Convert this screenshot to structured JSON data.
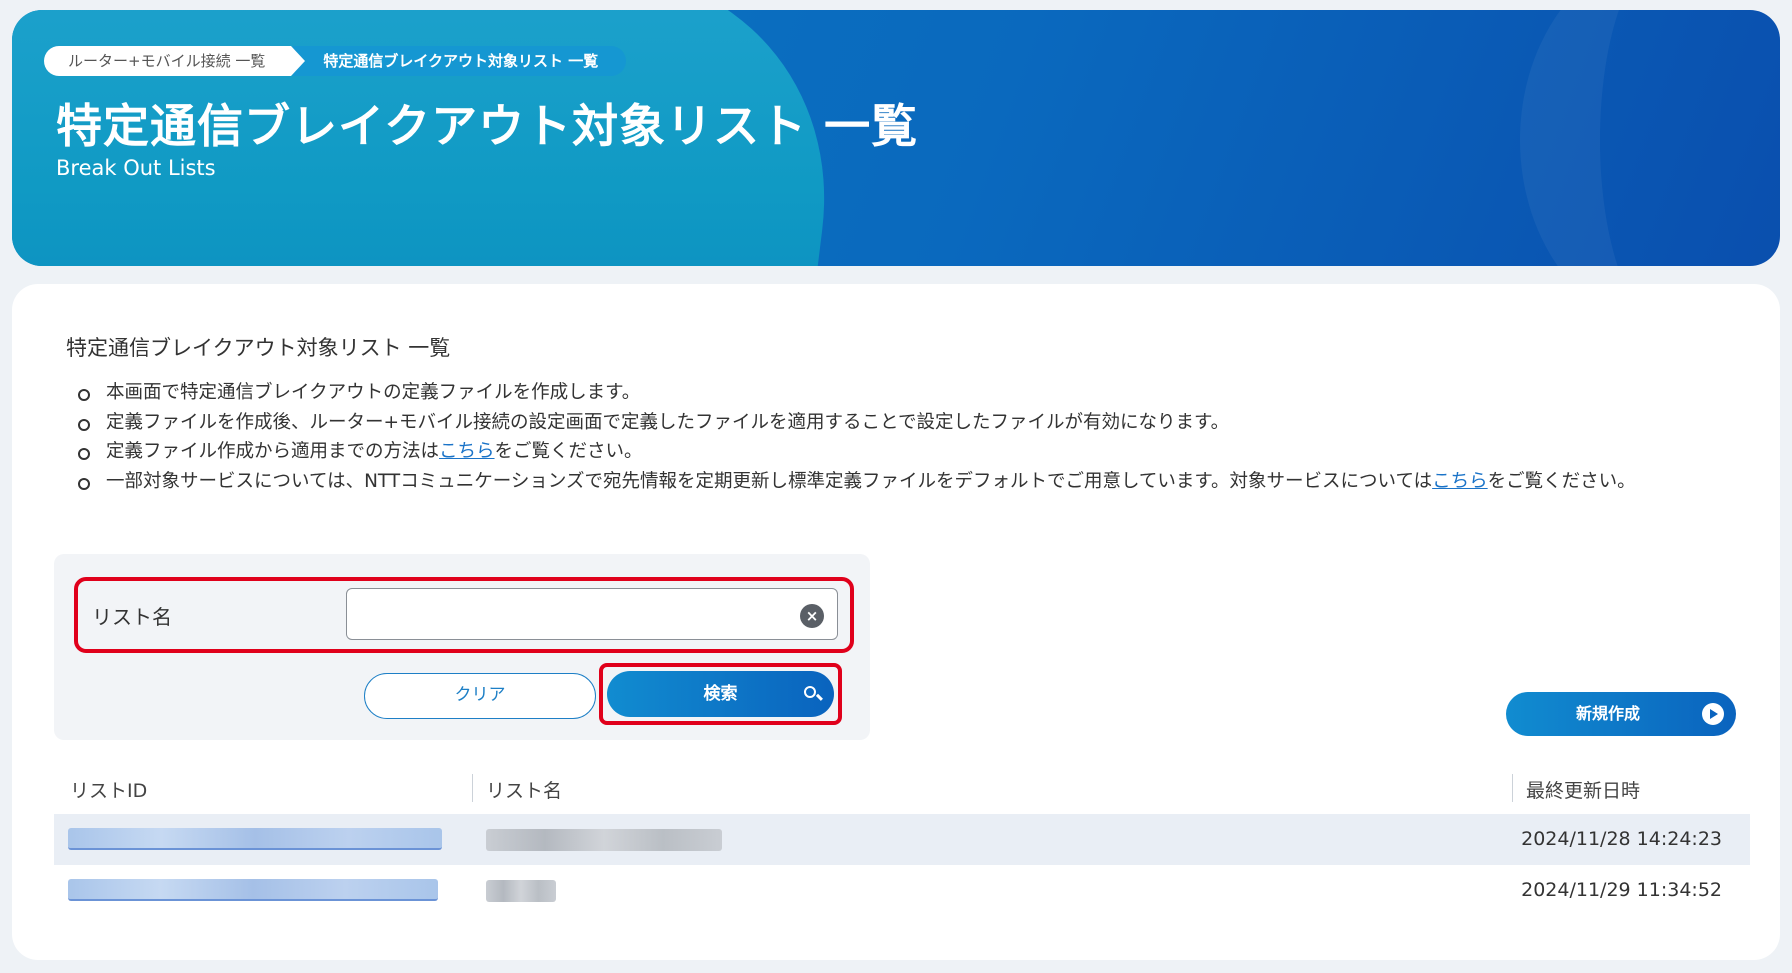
{
  "breadcrumb": {
    "parent": "ルーター+モバイル接続 一覧",
    "current": "特定通信ブレイクアウト対象リスト 一覧"
  },
  "header": {
    "title": "特定通信ブレイクアウト対象リスト 一覧",
    "subtitle": "Break Out Lists"
  },
  "section": {
    "title": "特定通信ブレイクアウト対象リスト 一覧",
    "bullets": {
      "b1": "本画面で特定通信ブレイクアウトの定義ファイルを作成します。",
      "b2": "定義ファイルを作成後、ルーター+モバイル接続の設定画面で定義したファイルを適用することで設定したファイルが有効になります。",
      "b3_pre": "定義ファイル作成から適用までの方法は",
      "b3_link": "こちら",
      "b3_post": "をご覧ください。",
      "b4_pre": "一部対象サービスについては、NTTコミュニケーションズで宛先情報を定期更新し標準定義ファイルをデフォルトでご用意しています。対象サービスについては",
      "b4_link": "こちら",
      "b4_post": "をご覧ください。"
    }
  },
  "search": {
    "label": "リスト名",
    "clear_label": "クリア",
    "search_label": "検索",
    "clear_icon": "×"
  },
  "actions": {
    "new_label": "新規作成"
  },
  "table": {
    "columns": {
      "id": "リストID",
      "name": "リスト名",
      "updated": "最終更新日時"
    },
    "rows": [
      {
        "updated": "2024/11/28 14:24:23"
      },
      {
        "updated": "2024/11/29 11:34:52"
      }
    ]
  },
  "colors": {
    "accent": "#0a79c2",
    "highlight": "#e0001b",
    "link": "#1a73c8"
  },
  "icons": {
    "search": "search-icon",
    "clear": "clear-icon",
    "new": "play-circle-icon"
  }
}
